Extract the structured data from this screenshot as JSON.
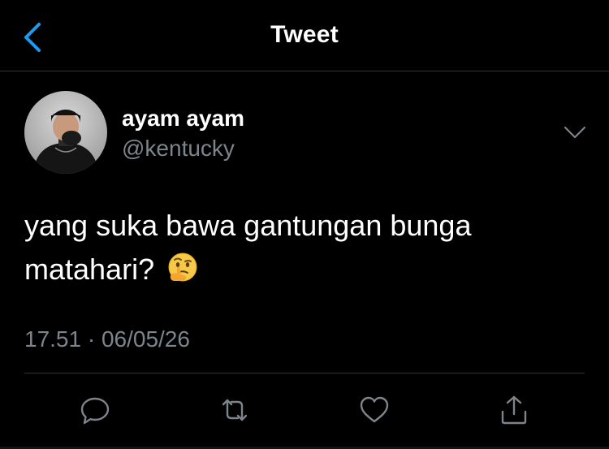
{
  "header": {
    "title": "Tweet",
    "back_icon": "chevron-left-icon"
  },
  "tweet": {
    "display_name": "ayam ayam",
    "handle": "@kentucky",
    "text": "yang suka bawa gantungan bunga matahari?",
    "emoji": "thinking-face-emoji",
    "timestamp": "17.51 · 06/05/26"
  },
  "actions": [
    "reply-icon",
    "retweet-icon",
    "like-icon",
    "share-icon"
  ],
  "colors": {
    "background": "#000000",
    "text_primary": "#ffffff",
    "text_secondary": "#7c848c",
    "accent": "#1d9bf0",
    "divider": "#2f3336"
  }
}
